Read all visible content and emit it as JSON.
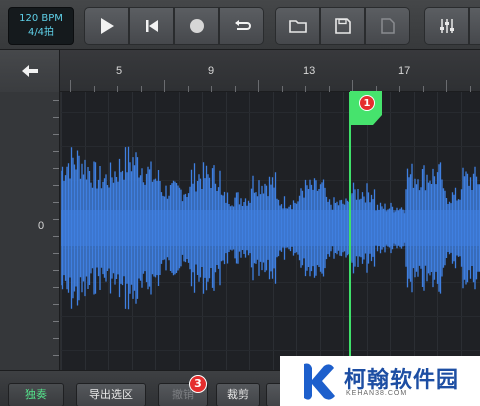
{
  "header": {
    "tempo": {
      "bpm": "120 BPM",
      "time_signature": "4/4拍"
    },
    "transport": [
      {
        "name": "play-button",
        "icon": "play-icon"
      },
      {
        "name": "rewind-button",
        "icon": "skip-to-start-icon"
      },
      {
        "name": "record-button",
        "icon": "record-icon"
      },
      {
        "name": "loop-button",
        "icon": "loop-icon"
      }
    ],
    "file_actions": [
      {
        "name": "open-button",
        "icon": "folder-icon"
      },
      {
        "name": "save-button",
        "icon": "floppy-disk-icon"
      },
      {
        "name": "new-file-button",
        "icon": "document-icon",
        "disabled": true
      }
    ],
    "mixer": {
      "name": "mixer-button",
      "icon": "sliders-icon"
    }
  },
  "ruler": {
    "back_icon": "arrow-left-icon",
    "bars": [
      "5",
      "9",
      "13",
      "17"
    ]
  },
  "track": {
    "zero_label": "0",
    "marker_number": "1",
    "colors": {
      "waveform": "#3f7fe0",
      "playhead": "#3fe06a",
      "marker": "#46e36d"
    }
  },
  "bottom_bar": {
    "solo": "独奏",
    "export_selection": "导出选区",
    "undo": "撤销",
    "undo_badge": "3",
    "cut": "裁剪"
  },
  "watermark": {
    "title": "柯翰软件园",
    "url": "KEHAN38.COM"
  }
}
